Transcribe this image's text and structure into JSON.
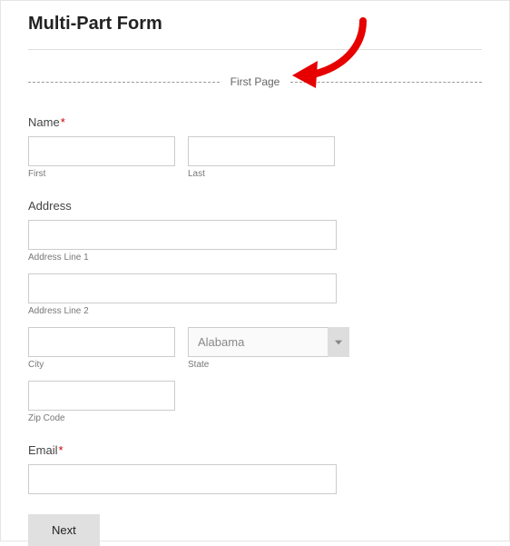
{
  "title": "Multi-Part Form",
  "page_break_label": "First Page",
  "fields": {
    "name": {
      "label": "Name",
      "required_mark": "*",
      "first_value": "",
      "first_sublabel": "First",
      "last_value": "",
      "last_sublabel": "Last"
    },
    "address": {
      "label": "Address",
      "line1_value": "",
      "line1_sublabel": "Address Line 1",
      "line2_value": "",
      "line2_sublabel": "Address Line 2",
      "city_value": "",
      "city_sublabel": "City",
      "state_selected": "Alabama",
      "state_sublabel": "State",
      "zip_value": "",
      "zip_sublabel": "Zip Code"
    },
    "email": {
      "label": "Email",
      "required_mark": "*",
      "value": ""
    }
  },
  "buttons": {
    "next": "Next"
  }
}
